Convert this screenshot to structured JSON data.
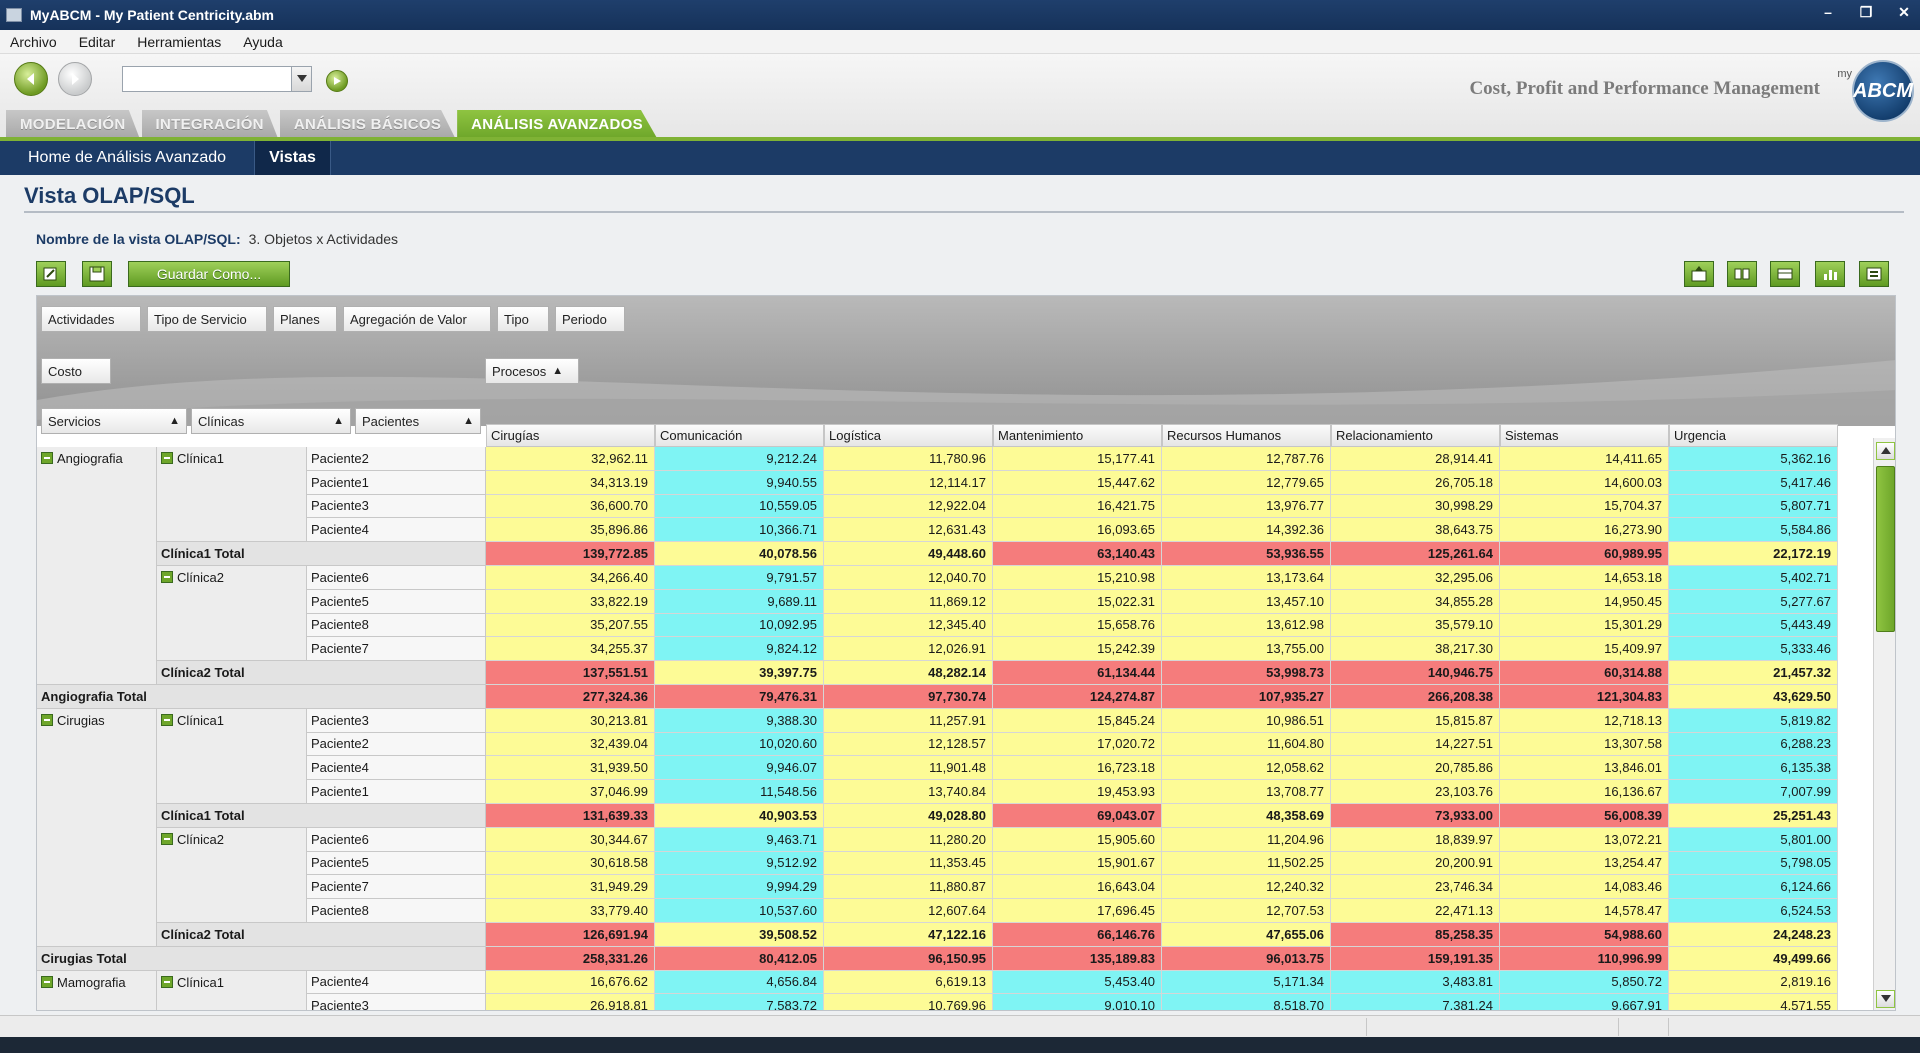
{
  "window": {
    "title": "MyABCM  - My Patient Centricity.abm"
  },
  "menu": [
    "Archivo",
    "Editar",
    "Herramientas",
    "Ayuda"
  ],
  "header": {
    "tagline": "Cost, Profit and Performance Management",
    "logo_text": "ABCM",
    "logo_my": "my"
  },
  "module_tabs": [
    {
      "label": "MODELACIÓN",
      "active": false
    },
    {
      "label": "INTEGRACIÓN",
      "active": false
    },
    {
      "label": "ANÁLISIS BÁSICOS",
      "active": false
    },
    {
      "label": "ANÁLISIS AVANZADOS",
      "active": true
    }
  ],
  "subnav": [
    {
      "label": "Home de Análisis Avanzado",
      "active": false
    },
    {
      "label": "Vistas",
      "active": true
    }
  ],
  "page": {
    "title": "Vista OLAP/SQL",
    "view_label": "Nombre de la vista OLAP/SQL:",
    "view_name": "3. Objetos x Actividades",
    "save_as": "Guardar Como..."
  },
  "filter_fields": [
    "Actividades",
    "Tipo de Servicio",
    "Planes",
    "Agregación de Valor",
    "Tipo",
    "Periodo"
  ],
  "data_field": "Costo",
  "column_field": "Procesos",
  "row_fields": [
    "Servicios",
    "Clínicas",
    "Pacientes"
  ],
  "columns": [
    "Cirugías",
    "Comunicación",
    "Logística",
    "Mantenimiento",
    "Recursos Humanos",
    "Relacionamiento",
    "Sistemas",
    "Urgencia"
  ],
  "colors": {
    "yellow": "#fdfb96",
    "cyan": "#7ff4f4",
    "red": "#f57c7c",
    "accent": "#6ea62a",
    "navy": "#1c3b66"
  },
  "rows": [
    {
      "kind": "data",
      "servicio": "Angiografia",
      "clinica": "Clínica1",
      "paciente": "Paciente2",
      "values": [
        "32,962.11",
        "9,212.24",
        "11,780.96",
        "15,177.41",
        "12,787.76",
        "28,914.41",
        "14,411.65",
        "5,362.16"
      ],
      "colors": "ycyyyyyc"
    },
    {
      "kind": "data",
      "paciente": "Paciente1",
      "values": [
        "34,313.19",
        "9,940.55",
        "12,114.17",
        "15,447.62",
        "12,779.65",
        "26,705.18",
        "14,600.03",
        "5,417.46"
      ],
      "colors": "ycyyyyyc"
    },
    {
      "kind": "data",
      "paciente": "Paciente3",
      "values": [
        "36,600.70",
        "10,559.05",
        "12,922.04",
        "16,421.75",
        "13,976.77",
        "30,998.29",
        "15,704.37",
        "5,807.71"
      ],
      "colors": "ycyyyyyc"
    },
    {
      "kind": "data",
      "paciente": "Paciente4",
      "values": [
        "35,896.86",
        "10,366.71",
        "12,631.43",
        "16,093.65",
        "14,392.36",
        "38,643.75",
        "16,273.90",
        "5,584.86"
      ],
      "colors": "ycyyyyyc"
    },
    {
      "kind": "ctotal",
      "label": "Clínica1 Total",
      "values": [
        "139,772.85",
        "40,078.56",
        "49,448.60",
        "63,140.43",
        "53,936.55",
        "125,261.64",
        "60,989.95",
        "22,172.19"
      ],
      "colors": "ryyrrrry"
    },
    {
      "kind": "data",
      "clinica": "Clínica2",
      "paciente": "Paciente6",
      "values": [
        "34,266.40",
        "9,791.57",
        "12,040.70",
        "15,210.98",
        "13,173.64",
        "32,295.06",
        "14,653.18",
        "5,402.71"
      ],
      "colors": "ycyyyyyc"
    },
    {
      "kind": "data",
      "paciente": "Paciente5",
      "values": [
        "33,822.19",
        "9,689.11",
        "11,869.12",
        "15,022.31",
        "13,457.10",
        "34,855.28",
        "14,950.45",
        "5,277.67"
      ],
      "colors": "ycyyyyyc"
    },
    {
      "kind": "data",
      "paciente": "Paciente8",
      "values": [
        "35,207.55",
        "10,092.95",
        "12,345.40",
        "15,658.76",
        "13,612.98",
        "35,579.10",
        "15,301.29",
        "5,443.49"
      ],
      "colors": "ycyyyyyc"
    },
    {
      "kind": "data",
      "paciente": "Paciente7",
      "values": [
        "34,255.37",
        "9,824.12",
        "12,026.91",
        "15,242.39",
        "13,755.00",
        "38,217.30",
        "15,409.97",
        "5,333.46"
      ],
      "colors": "ycyyyyyc"
    },
    {
      "kind": "ctotal",
      "label": "Clínica2 Total",
      "values": [
        "137,551.51",
        "39,397.75",
        "48,282.14",
        "61,134.44",
        "53,998.73",
        "140,946.75",
        "60,314.88",
        "21,457.32"
      ],
      "colors": "ryyrrrry"
    },
    {
      "kind": "stotal",
      "label": "Angiografia Total",
      "values": [
        "277,324.36",
        "79,476.31",
        "97,730.74",
        "124,274.87",
        "107,935.27",
        "266,208.38",
        "121,304.83",
        "43,629.50"
      ],
      "colors": "rrrrrrry"
    },
    {
      "kind": "data",
      "servicio": "Cirugias",
      "clinica": "Clínica1",
      "paciente": "Paciente3",
      "values": [
        "30,213.81",
        "9,388.30",
        "11,257.91",
        "15,845.24",
        "10,986.51",
        "15,815.87",
        "12,718.13",
        "5,819.82"
      ],
      "colors": "ycyyyyyc"
    },
    {
      "kind": "data",
      "paciente": "Paciente2",
      "values": [
        "32,439.04",
        "10,020.60",
        "12,128.57",
        "17,020.72",
        "11,604.80",
        "14,227.51",
        "13,307.58",
        "6,288.23"
      ],
      "colors": "ycyyyyyc"
    },
    {
      "kind": "data",
      "paciente": "Paciente4",
      "values": [
        "31,939.50",
        "9,946.07",
        "11,901.48",
        "16,723.18",
        "12,058.62",
        "20,785.86",
        "13,846.01",
        "6,135.38"
      ],
      "colors": "ycyyyyyc"
    },
    {
      "kind": "data",
      "paciente": "Paciente1",
      "values": [
        "37,046.99",
        "11,548.56",
        "13,740.84",
        "19,453.93",
        "13,708.77",
        "23,103.76",
        "16,136.67",
        "7,007.99"
      ],
      "colors": "ycyyyyyc"
    },
    {
      "kind": "ctotal",
      "label": "Clínica1 Total",
      "values": [
        "131,639.33",
        "40,903.53",
        "49,028.80",
        "69,043.07",
        "48,358.69",
        "73,933.00",
        "56,008.39",
        "25,251.43"
      ],
      "colors": "ryyryrry"
    },
    {
      "kind": "data",
      "clinica": "Clínica2",
      "paciente": "Paciente6",
      "values": [
        "30,344.67",
        "9,463.71",
        "11,280.20",
        "15,905.60",
        "11,204.96",
        "18,839.97",
        "13,072.21",
        "5,801.00"
      ],
      "colors": "ycyyyyyc"
    },
    {
      "kind": "data",
      "paciente": "Paciente5",
      "values": [
        "30,618.58",
        "9,512.92",
        "11,353.45",
        "15,901.67",
        "11,502.25",
        "20,200.91",
        "13,254.47",
        "5,798.05"
      ],
      "colors": "ycyyyyyc"
    },
    {
      "kind": "data",
      "paciente": "Paciente7",
      "values": [
        "31,949.29",
        "9,994.29",
        "11,880.87",
        "16,643.04",
        "12,240.32",
        "23,746.34",
        "14,083.46",
        "6,124.66"
      ],
      "colors": "ycyyyyyc"
    },
    {
      "kind": "data",
      "paciente": "Paciente8",
      "values": [
        "33,779.40",
        "10,537.60",
        "12,607.64",
        "17,696.45",
        "12,707.53",
        "22,471.13",
        "14,578.47",
        "6,524.53"
      ],
      "colors": "ycyyyyyc"
    },
    {
      "kind": "ctotal",
      "label": "Clínica2 Total",
      "values": [
        "126,691.94",
        "39,508.52",
        "47,122.16",
        "66,146.76",
        "47,655.06",
        "85,258.35",
        "54,988.60",
        "24,248.23"
      ],
      "colors": "ryyryrry"
    },
    {
      "kind": "stotal",
      "label": "Cirugias Total",
      "values": [
        "258,331.26",
        "80,412.05",
        "96,150.95",
        "135,189.83",
        "96,013.75",
        "159,191.35",
        "110,996.99",
        "49,499.66"
      ],
      "colors": "rrrrrrry"
    },
    {
      "kind": "data",
      "servicio": "Mamografia",
      "clinica": "Clínica1",
      "paciente": "Paciente4",
      "values": [
        "16,676.62",
        "4,656.84",
        "6,619.13",
        "5,453.40",
        "5,171.34",
        "3,483.81",
        "5,850.72",
        "2,819.16"
      ],
      "colors": "ycyccccy"
    },
    {
      "kind": "data",
      "paciente": "Paciente3",
      "values": [
        "26,918.81",
        "7,583.72",
        "10,769.96",
        "9,010.10",
        "8,518.70",
        "7,381.24",
        "9,667.91",
        "4,571.55"
      ],
      "colors": "ycyccccy"
    }
  ]
}
